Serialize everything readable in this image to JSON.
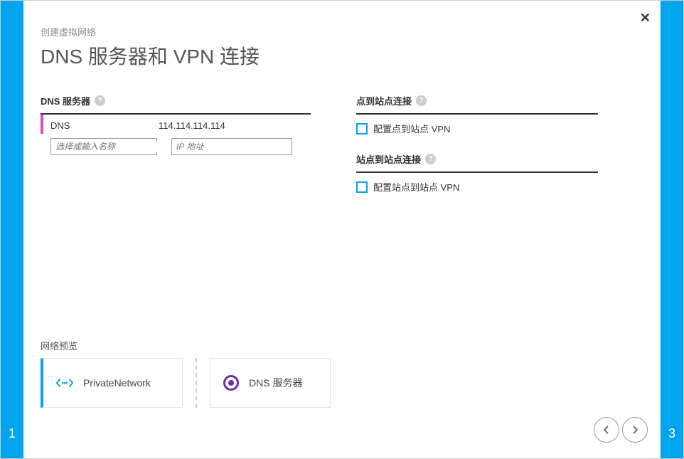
{
  "wizard": {
    "left_step": "1",
    "right_step": "3"
  },
  "breadcrumb": "创建虚拟网络",
  "title": "DNS 服务器和 VPN 连接",
  "dns": {
    "section_label": "DNS 服务器",
    "entry": {
      "name": "DNS",
      "ip": "114.114.114.114"
    },
    "name_placeholder": "选择或输入名称",
    "ip_placeholder": "IP 地址"
  },
  "p2s": {
    "section_label": "点到站点连接",
    "checkbox_label": "配置点到站点 VPN"
  },
  "s2s": {
    "section_label": "站点到站点连接",
    "checkbox_label": "配置站点到站点 VPN"
  },
  "preview": {
    "label": "网络预览",
    "network_name": "PrivateNetwork",
    "dns_label": "DNS 服务器"
  }
}
